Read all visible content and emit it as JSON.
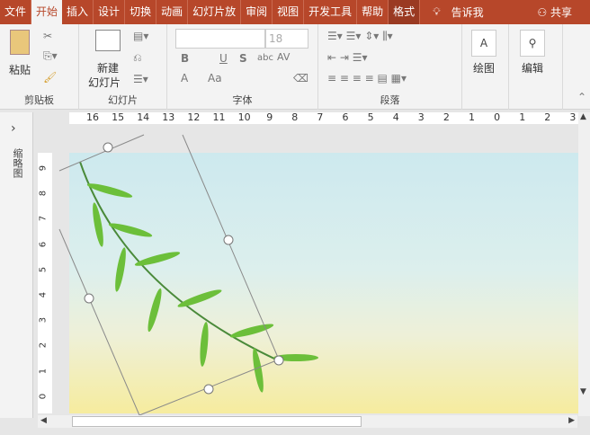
{
  "tabs": [
    "文件",
    "开始",
    "插入",
    "设计",
    "切换",
    "动画",
    "幻灯片放",
    "审阅",
    "视图",
    "开发工具",
    "帮助",
    "格式"
  ],
  "tell_me": "告诉我",
  "share": "共享",
  "clipboard": {
    "paste": "粘贴",
    "label": "剪贴板"
  },
  "slides": {
    "new_slide": "新建",
    "new_slide2": "幻灯片",
    "label": "幻灯片"
  },
  "font": {
    "size": "18",
    "label": "字体",
    "bold": "B",
    "underline": "U",
    "shadow": "S",
    "strike": "abc",
    "spacing": "AV",
    "color": "A",
    "case": "Aa"
  },
  "paragraph": {
    "label": "段落"
  },
  "drawing": {
    "label": "绘图"
  },
  "editing": {
    "label": "编辑"
  },
  "sidebar": {
    "label": "缩略图"
  },
  "ruler_h": [
    "16",
    "15",
    "14",
    "13",
    "12",
    "11",
    "10",
    "9",
    "8",
    "7",
    "6",
    "5",
    "4",
    "3",
    "2",
    "1",
    "0",
    "1",
    "2",
    "3"
  ],
  "ruler_v": [
    "9",
    "8",
    "7",
    "6",
    "5",
    "4",
    "3",
    "2",
    "1",
    "0"
  ]
}
